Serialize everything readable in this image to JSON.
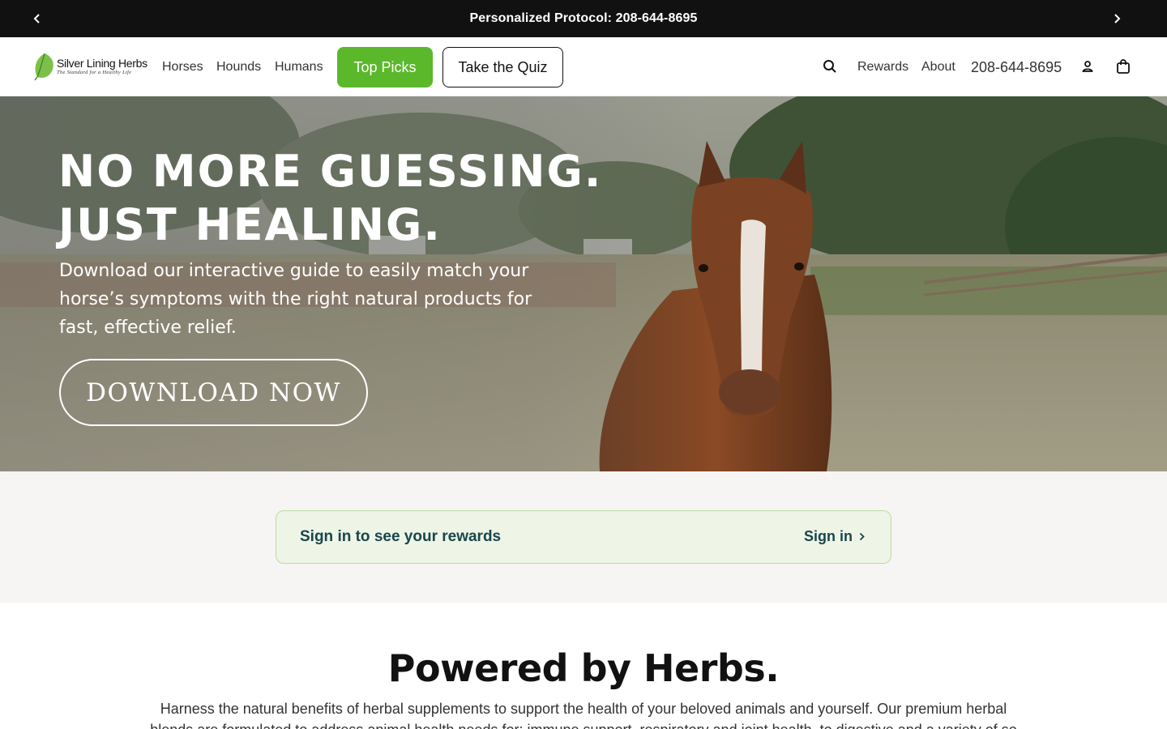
{
  "announcement": {
    "text": "Personalized Protocol: 208-644-8695",
    "prev_icon": "chevron-left-icon",
    "next_icon": "chevron-right-icon"
  },
  "header": {
    "logo": {
      "name": "Silver Lining Herbs",
      "tagline": "The Standard for a Healthy Life"
    },
    "nav": [
      "Horses",
      "Hounds",
      "Humans"
    ],
    "top_picks_label": "Top Picks",
    "quiz_label": "Take the Quiz",
    "rewards_label": "Rewards",
    "about_label": "About",
    "phone": "208-644-8695",
    "icons": [
      "search-icon",
      "account-icon",
      "cart-icon"
    ]
  },
  "hero": {
    "title_line1": "NO MORE GUESSING.",
    "title_line2": "JUST HEALING.",
    "subtitle": "Download our interactive guide to easily match your horse’s symptoms with the right natural products for fast, effective relief.",
    "cta": "DOWNLOAD NOW"
  },
  "rewards": {
    "message": "Sign in to see your rewards",
    "signin": "Sign in"
  },
  "powered": {
    "title": "Powered by Herbs.",
    "body": "Harness the natural benefits of herbal supplements to support the health of your beloved animals and yourself. Our premium herbal blends are formulated to address animal health needs for: immune support, respiratory and joint health, to digestive and a variety of so on."
  },
  "colors": {
    "accent_green": "#5bb82b",
    "rewards_text": "#18464c",
    "announcement_bg": "#111111"
  }
}
